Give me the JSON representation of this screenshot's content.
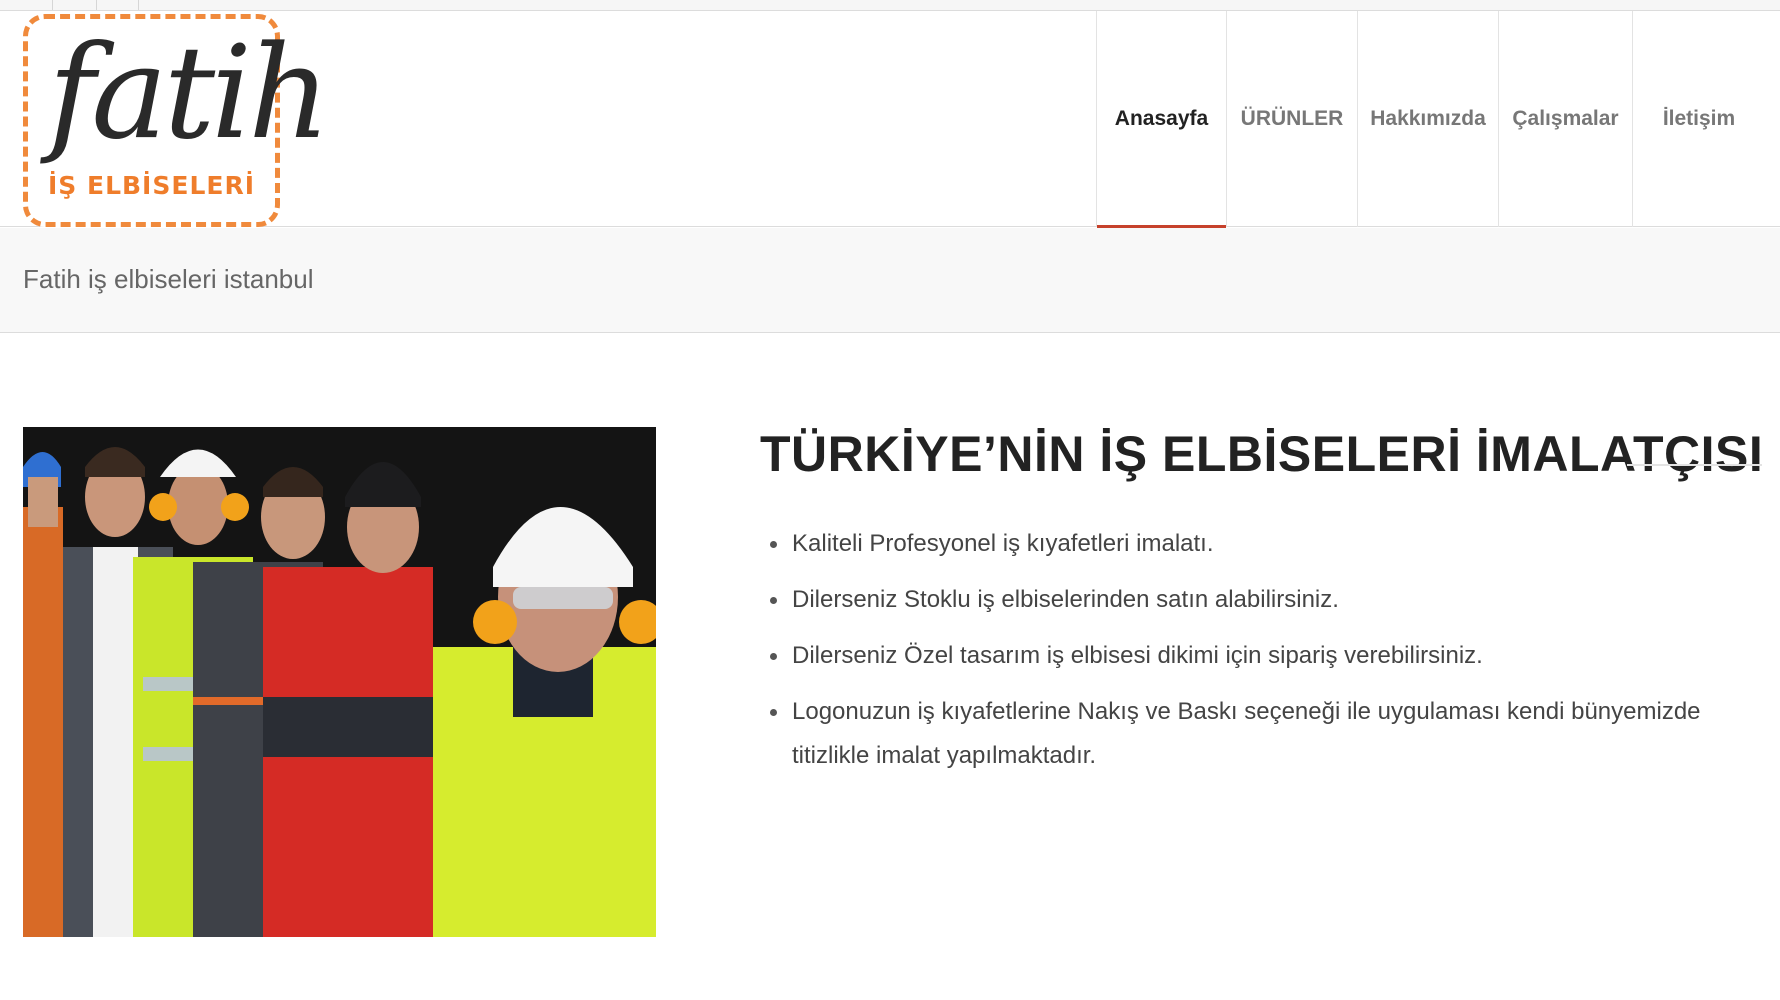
{
  "logo": {
    "word": "fatih",
    "subtitle": "İŞ ELBİSELERİ",
    "border_color": "#f08a3c"
  },
  "nav": {
    "items": [
      {
        "label": "Anasayfa",
        "active": true
      },
      {
        "label": "ÜRÜNLER",
        "active": false
      },
      {
        "label": "Hakkımızda",
        "active": false
      },
      {
        "label": "Çalışmalar",
        "active": false
      },
      {
        "label": "İletişim",
        "active": false
      }
    ],
    "active_color": "#c6412b"
  },
  "breadcrumb": {
    "text": "Fatih iş elbiseleri istanbul"
  },
  "main": {
    "headline": "TÜRKİYE’NİN İŞ ELBİSELERİ İMALATÇISI",
    "bullets": [
      "Kaliteli Profesyonel iş kıyafetleri imalatı.",
      "Dilerseniz Stoklu iş elbiselerinden satın alabilirsiniz.",
      "Dilerseniz Özel tasarım iş elbisesi dikimi için sipariş verebilirsiniz.",
      "Logonuzun iş kıyafetlerine Nakış ve Baskı seçeneği ile uygulaması kendi bünyemizde titizlikle imalat yapılmaktadır."
    ],
    "hero_image": "group-of-workers-in-safety-workwear"
  }
}
